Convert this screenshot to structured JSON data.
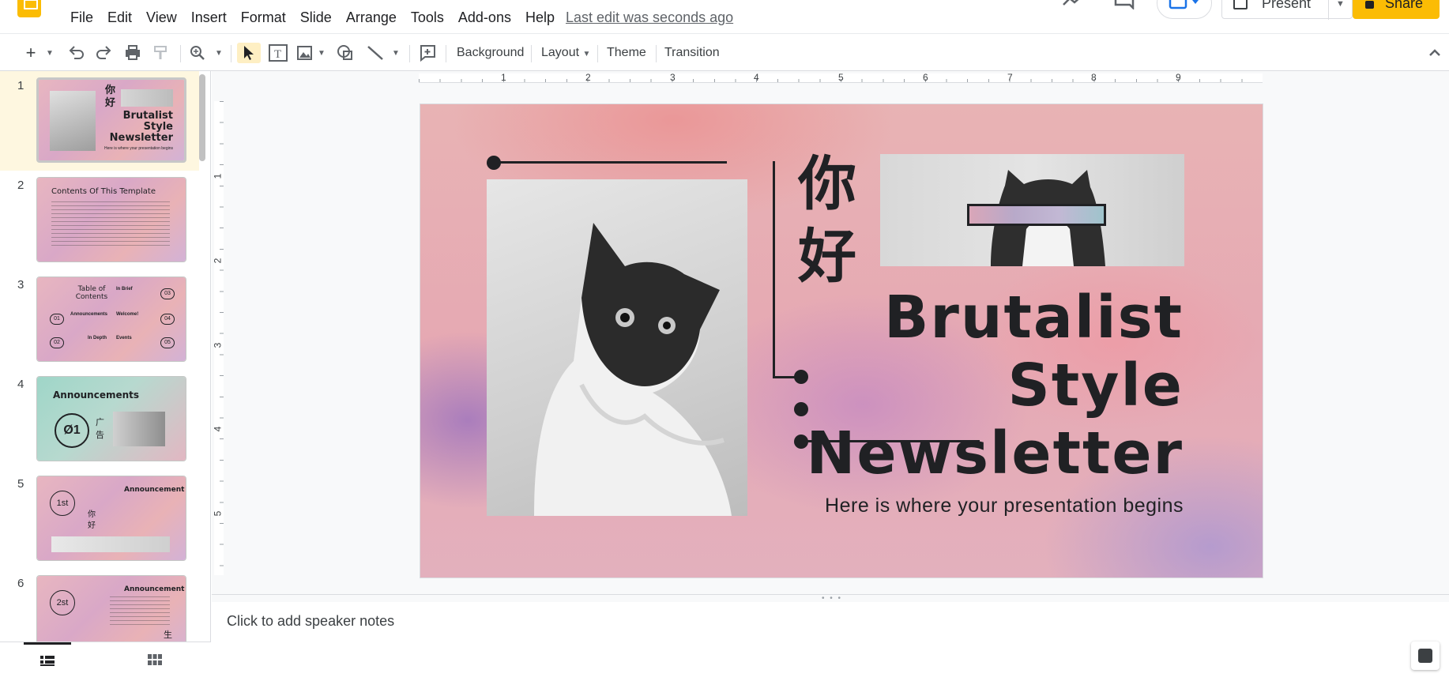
{
  "menu": {
    "items": [
      "File",
      "Edit",
      "View",
      "Insert",
      "Format",
      "Slide",
      "Arrange",
      "Tools",
      "Add-ons",
      "Help"
    ],
    "last_edit": "Last edit was seconds ago"
  },
  "header": {
    "present_label": "Present",
    "share_label": "Share"
  },
  "toolbar": {
    "background_label": "Background",
    "layout_label": "Layout",
    "theme_label": "Theme",
    "transition_label": "Transition"
  },
  "filmstrip": {
    "slides": [
      {
        "number": "1",
        "title": "Brutalist Style Newsletter"
      },
      {
        "number": "2",
        "title": "Contents Of This Template"
      },
      {
        "number": "3",
        "title": "Table of Contents"
      },
      {
        "number": "4",
        "title": "Announcements"
      },
      {
        "number": "5",
        "title": "Announcement"
      },
      {
        "number": "6",
        "title": "Announcement"
      }
    ],
    "thumb_texts": {
      "s3_in_brief": "In Brief",
      "s3_welcome": "Welcome!",
      "s3_in_depth": "In Depth",
      "s3_events": "Events",
      "s3_announcements": "Announcements",
      "s3_n01": "01",
      "s3_n02": "02",
      "s3_n03": "03",
      "s3_n04": "04",
      "s3_n05": "05",
      "s4_badge": "Ø1",
      "s4_chinese": "广告",
      "s5_badge": "1st",
      "s5_chinese": "你好",
      "s6_badge": "2st",
      "s6_chinese": "生"
    }
  },
  "rulers": {
    "top": [
      "1",
      "2",
      "3",
      "4",
      "5",
      "6",
      "7",
      "8",
      "9"
    ],
    "left": [
      "1",
      "2",
      "3",
      "4",
      "5"
    ]
  },
  "slide": {
    "chinese": "你好",
    "title_line1": "Brutalist",
    "title_line2": "Style",
    "title_line3": "Newsletter",
    "subtitle": "Here is where your presentation begins"
  },
  "notes": {
    "placeholder": "Click to add speaker notes"
  },
  "colors": {
    "accent": "#fbbc04",
    "selected_row": "#fef7e0",
    "tool_selected": "#feefc3"
  }
}
